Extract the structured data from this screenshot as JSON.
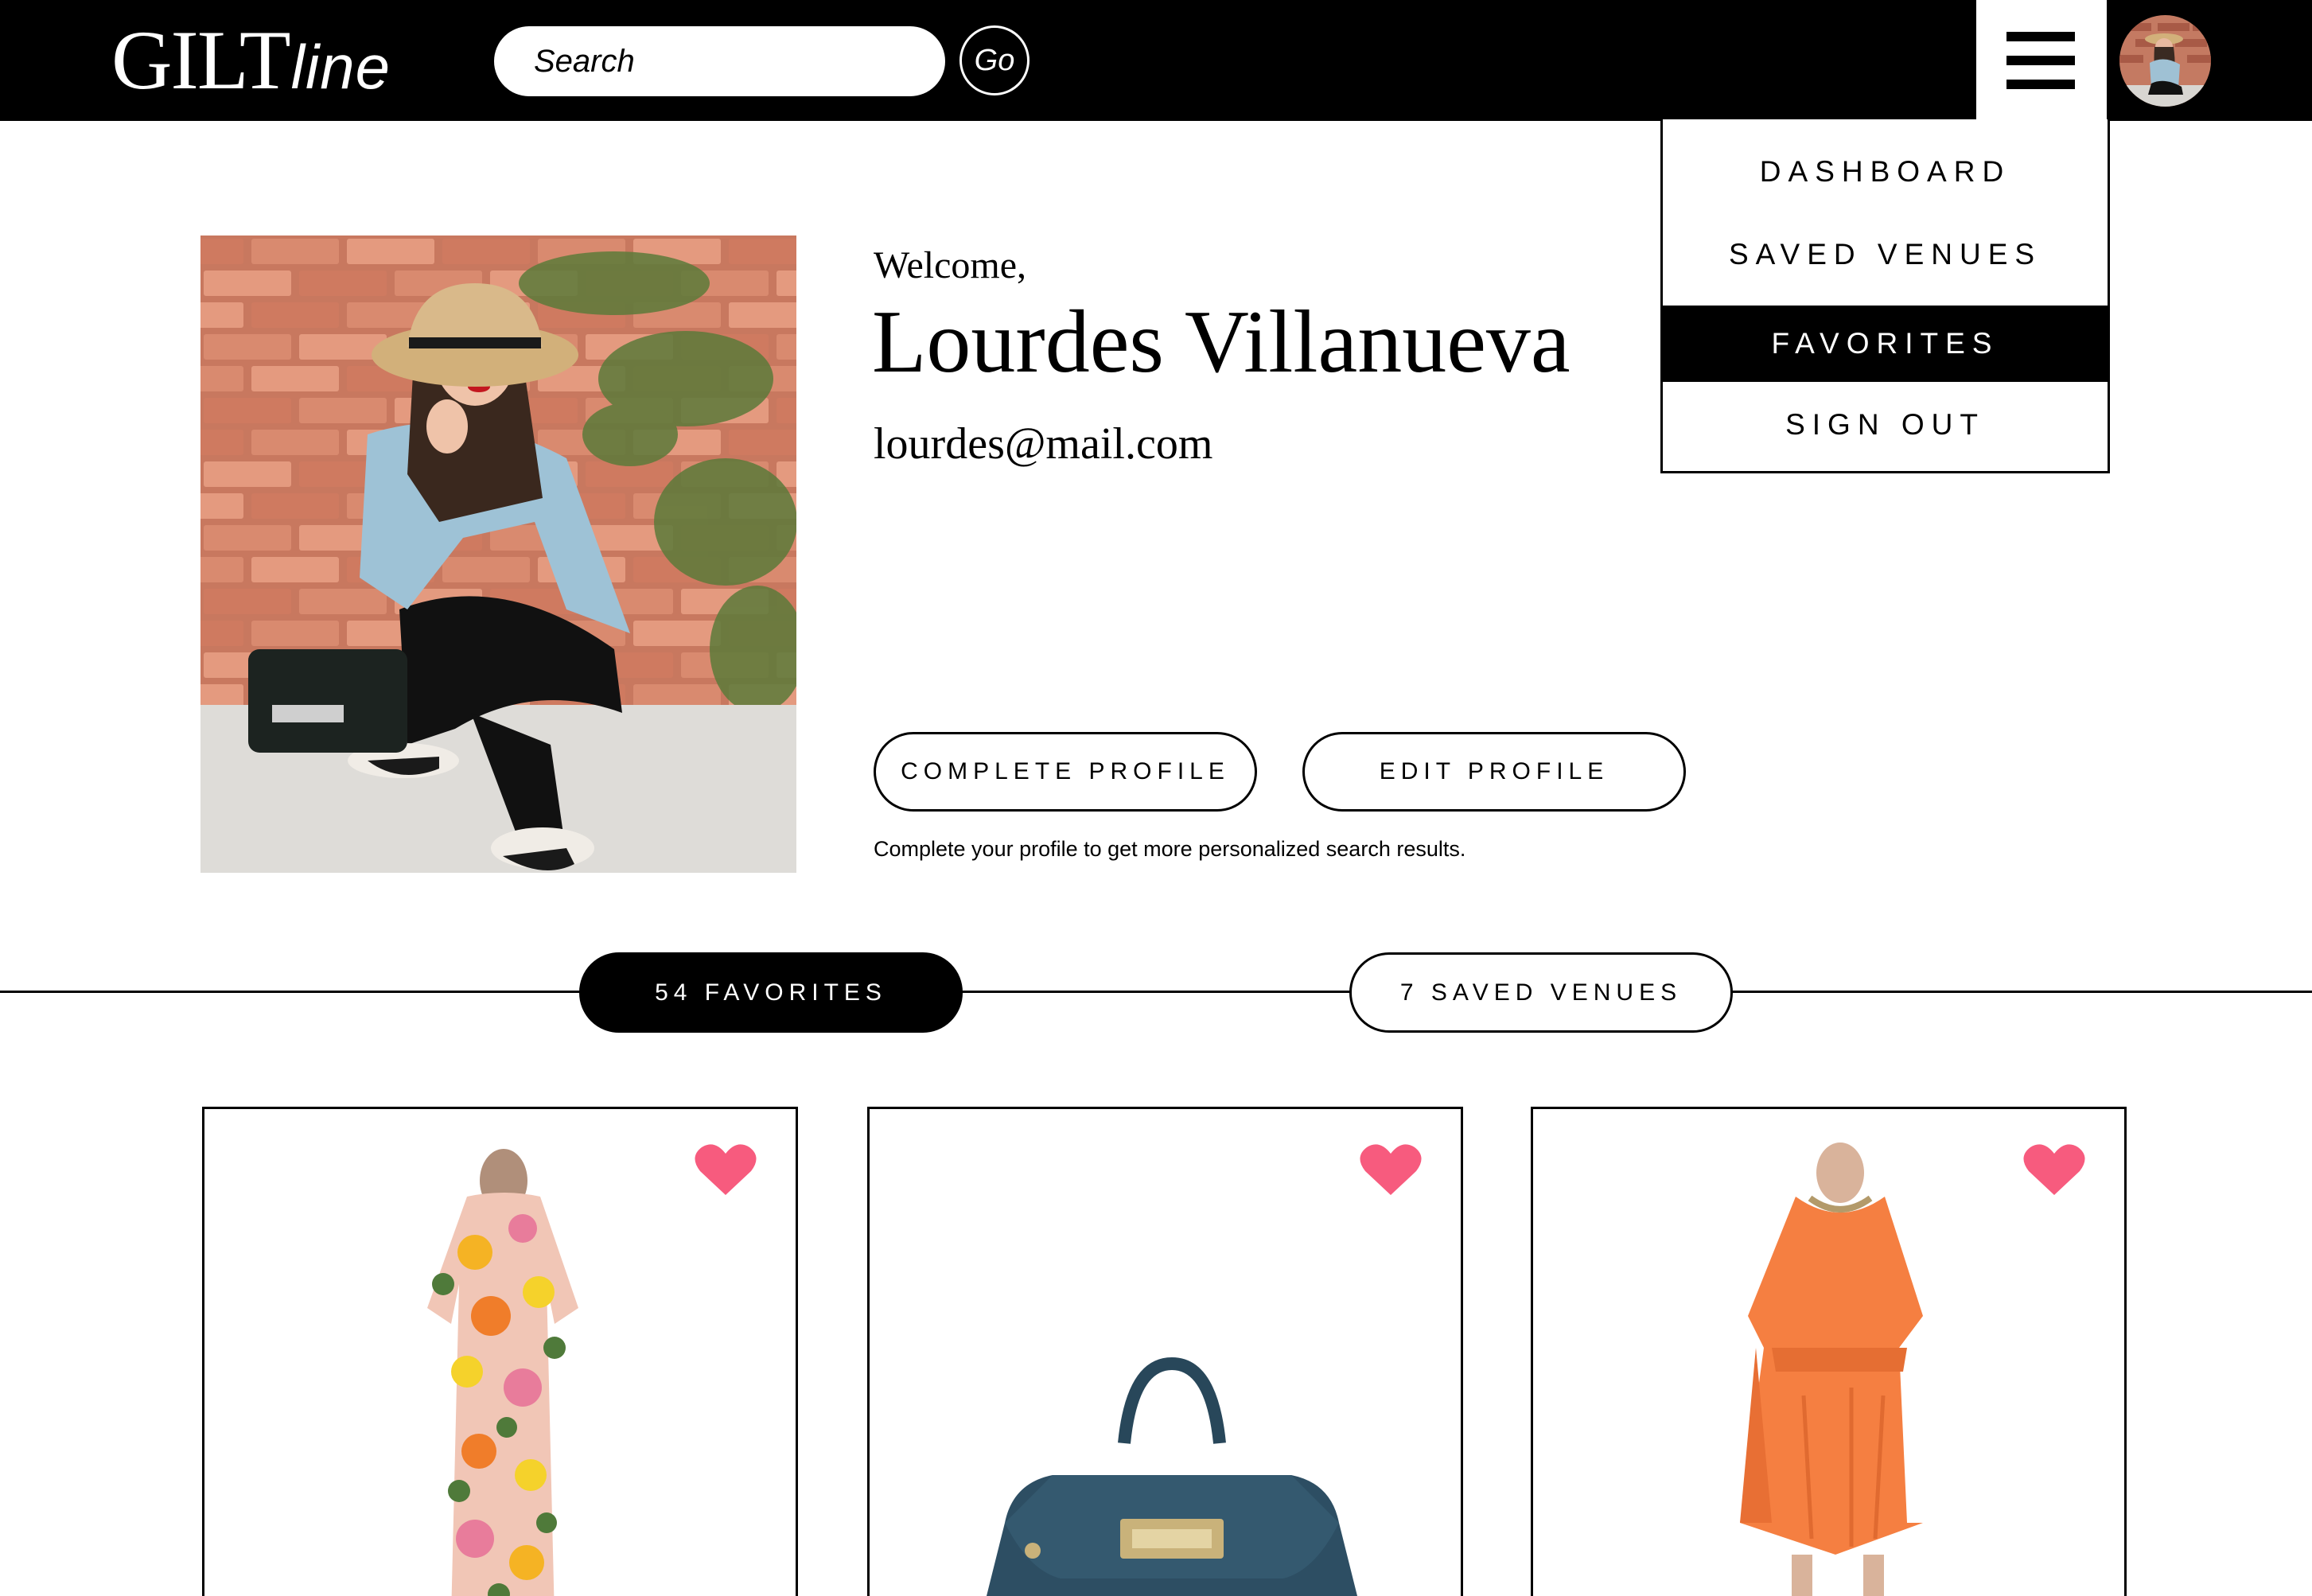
{
  "header": {
    "logo_main": "GILT",
    "logo_sub": "line",
    "search_placeholder": "Search",
    "go_label": "Go"
  },
  "menu": {
    "items": [
      {
        "label": "DASHBOARD",
        "active": false
      },
      {
        "label": "SAVED VENUES",
        "active": false
      },
      {
        "label": "FAVORITES",
        "active": true
      },
      {
        "label": "SIGN OUT",
        "active": false
      }
    ]
  },
  "profile": {
    "welcome": "Welcome,",
    "name": "Lourdes Villanueva",
    "email": "lourdes@mail.com",
    "complete_label": "COMPLETE PROFILE",
    "edit_label": "EDIT PROFILE",
    "hint": "Complete your profile to get more personalized search results."
  },
  "tabs": {
    "favorites": "54 FAVORITES",
    "venues": "7 SAVED VENUES"
  },
  "products": [
    {
      "kind": "floral-dress",
      "favorited": true
    },
    {
      "kind": "blue-handbag",
      "favorited": true
    },
    {
      "kind": "orange-dress",
      "favorited": true
    }
  ],
  "colors": {
    "heart": "#f75b7e",
    "accent": "#000000",
    "background": "#ffffff"
  },
  "icons": {
    "menu": "hamburger-icon",
    "favorite": "heart-icon"
  }
}
